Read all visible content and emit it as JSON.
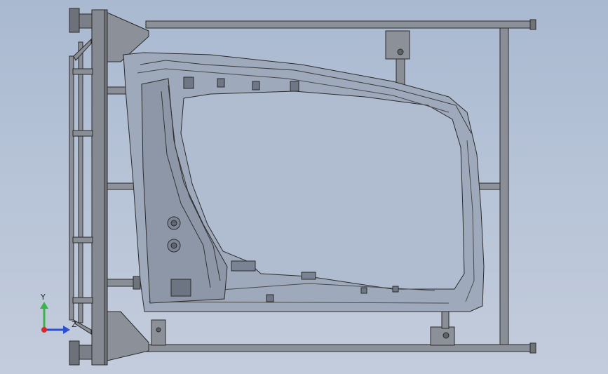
{
  "viewport": {
    "background_top": "#a9b9d0",
    "background_bottom": "#c3ccdc"
  },
  "model": {
    "description_icon": "car-door-fixture-model",
    "line_color": "#2b2b2b",
    "frame_fill": "#8f9299",
    "door_fill": "#9aa6b8"
  },
  "triad": {
    "y_label": "Y",
    "z_label": "Z",
    "y_color": "#3bb34a",
    "z_color": "#2a4fd0",
    "origin_color": "#d42a2a"
  }
}
